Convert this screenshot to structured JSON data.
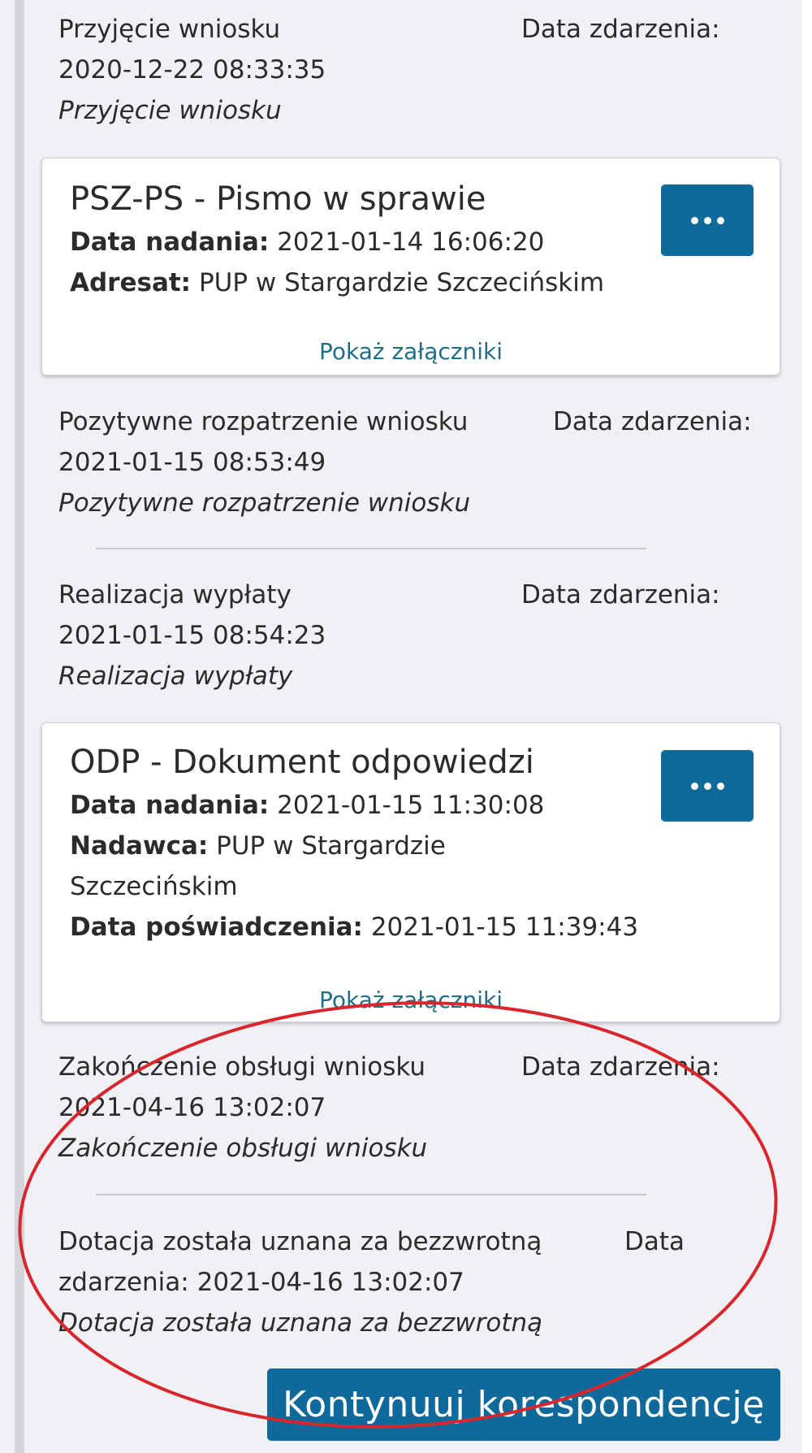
{
  "events": [
    {
      "title": "Przyjęcie wniosku",
      "date_label": "Data zdarzenia:",
      "date_value": "2020-12-22 08:33:35",
      "description": "Przyjęcie wniosku"
    },
    {
      "title": "Pozytywne rozpatrzenie wniosku",
      "date_label": "Data zdarzenia:",
      "date_value": "2021-01-15 08:53:49",
      "description": "Pozytywne rozpatrzenie wniosku"
    },
    {
      "title": "Realizacja wypłaty",
      "date_label": "Data zdarzenia:",
      "date_value": "2021-01-15 08:54:23",
      "description": "Realizacja wypłaty"
    },
    {
      "title": "Zakończenie obsługi wniosku",
      "date_label": "Data zdarzenia:",
      "date_value": "2021-04-16 13:02:07",
      "description": "Zakończenie obsługi wniosku"
    },
    {
      "title": "Dotacja została uznana za bezzwrotną",
      "date_label_word1": "Data",
      "date_label_word2": "zdarzenia:",
      "date_value": "2021-04-16 13:02:07",
      "description": "Dotacja została uznana za bezzwrotną"
    }
  ],
  "documents": [
    {
      "title": "PSZ-PS - Pismo w sprawie",
      "sent_label": "Data nadania:",
      "sent_value": "2021-01-14 16:06:20",
      "party_label": "Adresat:",
      "party_value": "PUP w Stargardzie Szczecińskim",
      "attachments_link": "Pokaż załączniki",
      "menu_icon": "ellipsis-icon"
    },
    {
      "title": "ODP - Dokument odpowiedzi",
      "sent_label": "Data nadania:",
      "sent_value": "2021-01-15 11:30:08",
      "party_label": "Nadawca:",
      "party_value_line1": "PUP w Stargardzie",
      "party_value_line2": "Szczecińskim",
      "cert_label": "Data poświadczenia:",
      "cert_value": "2021-01-15 11:39:43",
      "attachments_link": "Pokaż załączniki",
      "menu_icon": "ellipsis-icon"
    }
  ],
  "continue_button": "Kontynuuj korespondencję",
  "colors": {
    "primary": "#0f6a9b",
    "link": "#1f6f8b",
    "background": "#f0f1f5",
    "annotation": "#d8262c"
  }
}
